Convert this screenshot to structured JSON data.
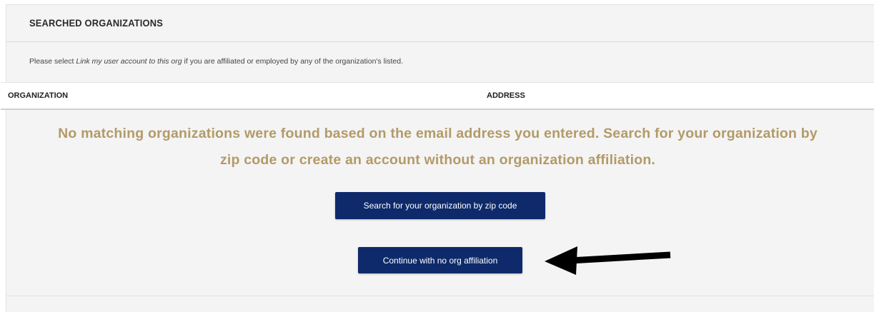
{
  "panel": {
    "title": "SEARCHED ORGANIZATIONS",
    "instructions_before": "Please select ",
    "instructions_link": "Link my user account to this org",
    "instructions_after": " if you are affiliated or employed by any of the organization's listed."
  },
  "table": {
    "headers": [
      "ORGANIZATION",
      "ADDRESS"
    ]
  },
  "message": {
    "line1": "No matching organizations were found based on the email address you entered. Search for your organization by",
    "line2": "zip code or create an account without an organization affiliation."
  },
  "buttons": {
    "zip_search_label": "Search for your organization by zip code",
    "no_affiliation_label": "Continue with no org affiliation"
  },
  "annotation": {
    "arrow_icon": "arrow-left-icon",
    "arrow_color": "#000000"
  },
  "colors": {
    "button_bg": "#0e2a6b",
    "message_text": "#b39a68",
    "panel_bg": "#f4f4f4"
  }
}
